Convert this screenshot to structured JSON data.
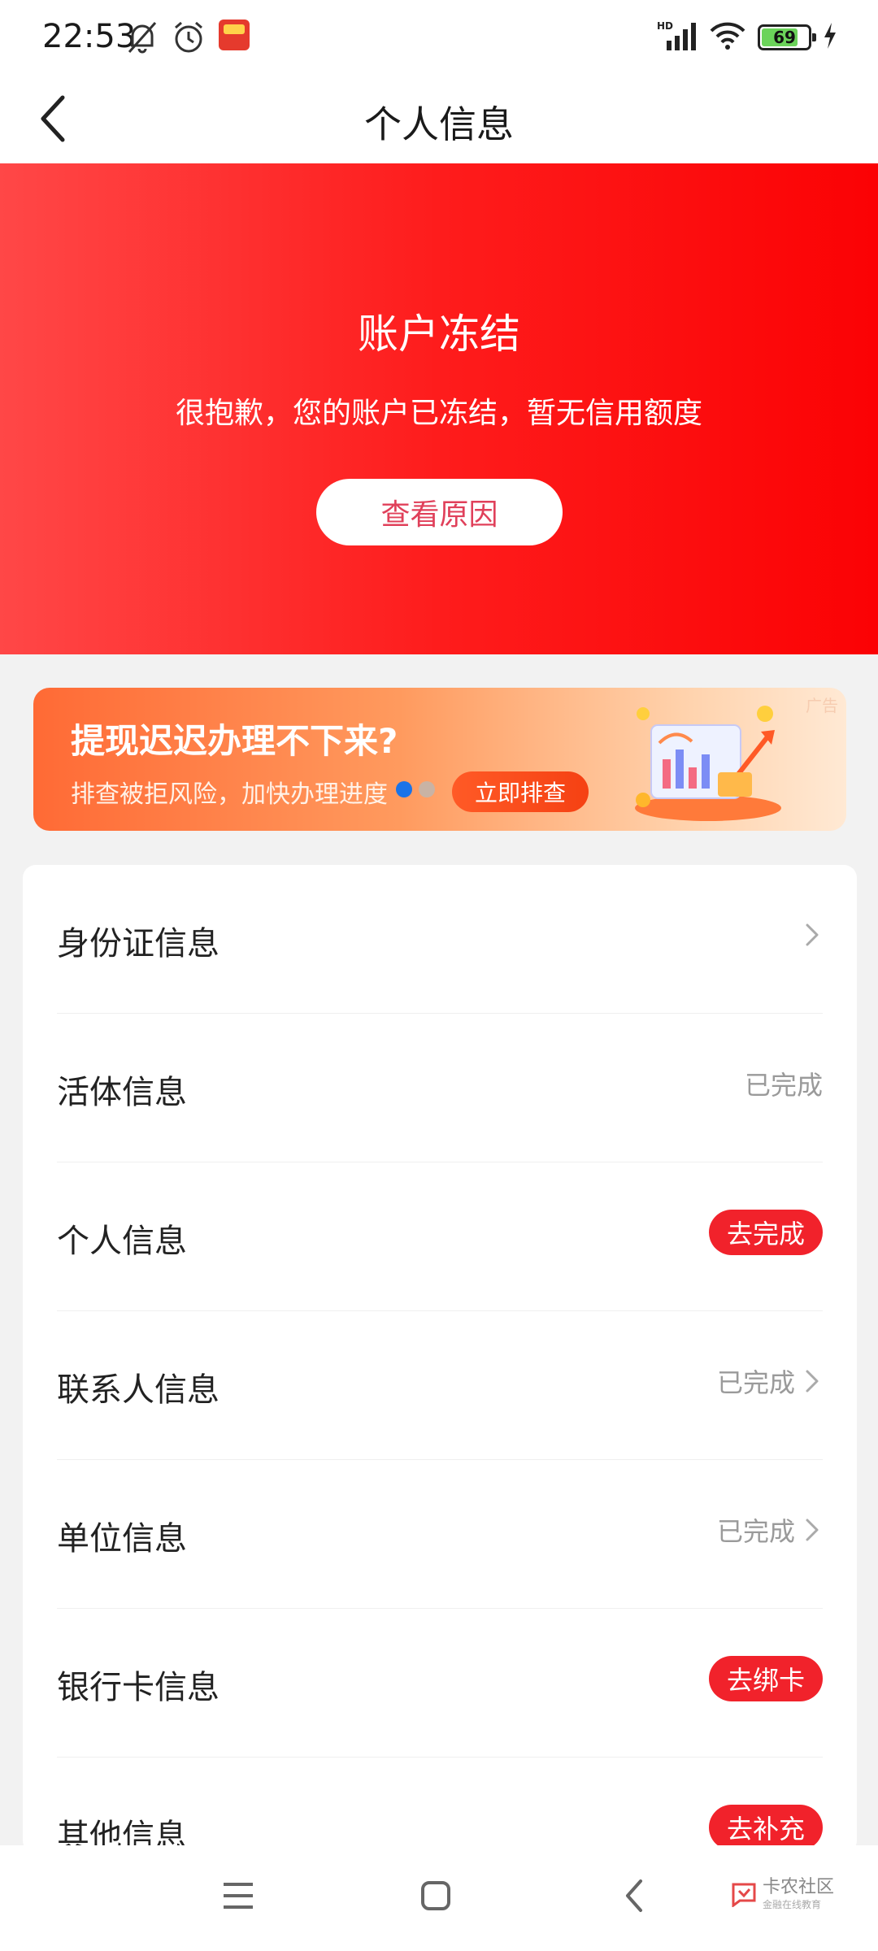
{
  "status_bar": {
    "time": "22:53",
    "network": "HD",
    "battery": "69",
    "icons": [
      "mute-bell-icon",
      "alarm-icon",
      "app-badge-icon",
      "signal-icon",
      "wifi-icon",
      "battery-icon",
      "charging-icon"
    ]
  },
  "header": {
    "title": "个人信息",
    "back_icon": "chevron-left-icon"
  },
  "frozen_banner": {
    "title": "账户冻结",
    "description": "很抱歉，您的账户已冻结，暂无信用额度",
    "button_label": "查看原因",
    "colors": {
      "start": "#ff4747",
      "end": "#fb0204"
    }
  },
  "ad": {
    "tag": "广告",
    "headline": "提现迟迟办理不下来?",
    "subtext": "排查被拒风险，加快办理进度",
    "cta_label": "立即排查",
    "carousel_active_index": 0,
    "carousel_count": 2
  },
  "info_list": [
    {
      "label": "身份证信息",
      "status": "",
      "action": "",
      "chevron": true
    },
    {
      "label": "活体信息",
      "status": "已完成",
      "action": "",
      "chevron": false
    },
    {
      "label": "个人信息",
      "status": "",
      "action": "去完成",
      "chevron": false
    },
    {
      "label": "联系人信息",
      "status": "已完成",
      "action": "",
      "chevron": true
    },
    {
      "label": "单位信息",
      "status": "已完成",
      "action": "",
      "chevron": true
    },
    {
      "label": "银行卡信息",
      "status": "",
      "action": "去绑卡",
      "chevron": false
    },
    {
      "label": "其他信息",
      "status": "",
      "action": "去补充",
      "chevron": false
    }
  ],
  "nav_bar": {
    "buttons": [
      "menu-icon",
      "home-icon",
      "back-icon"
    ]
  },
  "watermark": {
    "main": "卡农社区",
    "sub": "金融在线教育"
  },
  "theme": {
    "accent": "#f1222b",
    "muted_text": "#9a9a9a"
  }
}
